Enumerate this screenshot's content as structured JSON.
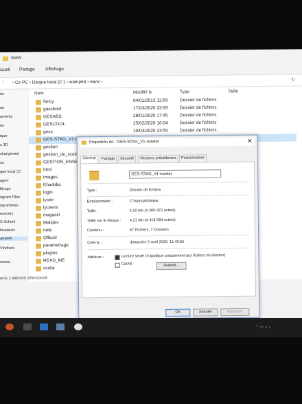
{
  "window": {
    "title": "www",
    "ribbon": [
      "ccueil",
      "Partage",
      "Affichage"
    ],
    "address": [
      "Ce PC",
      "Disque local (C:)",
      "wamp64",
      "www"
    ]
  },
  "sidebar": {
    "items": [
      "ès",
      "au",
      "uments",
      "es",
      "ique",
      "s 3D",
      "chargemen",
      "os",
      "que local (C:",
      "agon",
      "ftLogs",
      "ogram Files",
      "ogrammes",
      "ecovery",
      "S School",
      "ilisateurs",
      "amp64",
      "Vindows",
      "eseau"
    ]
  },
  "list": {
    "headers": {
      "name": "Nom",
      "modified": "Modifié le",
      "type": "Type",
      "size": "Taille"
    },
    "rows": [
      {
        "name": "fancy",
        "date": "04/01/2013 12:59",
        "type": "Dossier de fichiers"
      },
      {
        "name": "gaschool",
        "date": "17/03/2020 23:59",
        "type": "Dossier de fichiers"
      },
      {
        "name": "GESABS",
        "date": "28/01/2020 17:45",
        "type": "Dossier de fichiers"
      },
      {
        "name": "GESCOOL",
        "date": "25/02/2020 16:04",
        "type": "Dossier de fichiers"
      },
      {
        "name": "gess",
        "date": "10/03/2020 23:55",
        "type": "Dossier de fichiers"
      },
      {
        "name": "GES-STAG_V1-m",
        "date": "",
        "type": ""
      },
      {
        "name": "gestion",
        "date": "",
        "type": ""
      },
      {
        "name": "gestion_de_scola",
        "date": "",
        "type": ""
      },
      {
        "name": "GESTION_ENSEIG",
        "date": "",
        "type": ""
      },
      {
        "name": "html",
        "date": "",
        "type": ""
      },
      {
        "name": "images",
        "date": "",
        "type": ""
      },
      {
        "name": "Khadidia",
        "date": "",
        "type": ""
      },
      {
        "name": "login",
        "date": "",
        "type": ""
      },
      {
        "name": "lycée",
        "date": "",
        "type": ""
      },
      {
        "name": "lyceens",
        "date": "",
        "type": ""
      },
      {
        "name": "magasin",
        "date": "",
        "type": ""
      },
      {
        "name": "Malidev",
        "date": "",
        "type": ""
      },
      {
        "name": "note",
        "date": "",
        "type": ""
      },
      {
        "name": "Officiel",
        "date": "",
        "type": ""
      },
      {
        "name": "parametrage",
        "date": "",
        "type": ""
      },
      {
        "name": "plugins",
        "date": "",
        "type": ""
      },
      {
        "name": "READ_ME",
        "date": "",
        "type": ""
      },
      {
        "name": "scolai",
        "date": "",
        "type": ""
      }
    ],
    "status": "ents    1 élément sélectionné"
  },
  "dialog": {
    "title": "Propriétés de : GES-STAG_V1-master",
    "close": "✕",
    "tabs": [
      "Général",
      "Partage",
      "Sécurité",
      "Versions précédentes",
      "Personnaliser"
    ],
    "name_value": "GES-STAG_V1-master",
    "fields": [
      {
        "label": "Type :",
        "value": "Dossier de fichiers"
      },
      {
        "label": "Emplacement :",
        "value": "C:\\wamp64\\www"
      },
      {
        "label": "Taille :",
        "value": "4,10 Mo (4 300 872 octets)"
      },
      {
        "label": "Taille sur le disque :",
        "value": "4,21 Mo (4 419 584 octets)"
      },
      {
        "label": "Contenu :",
        "value": "67 Fichiers, 7 Dossiers"
      },
      {
        "label": "Créé le :",
        "value": "dimanche 5 avril 2020, 11:40:55"
      }
    ],
    "attributes_label": "Attributs :",
    "readonly_label": "Lecture seule (s'applique uniquement aux fichiers du dossier)",
    "hidden_label": "Caché",
    "advanced_button": "Avancé...",
    "ok": "OK",
    "cancel": "Annuler",
    "apply": "Appliquer"
  }
}
